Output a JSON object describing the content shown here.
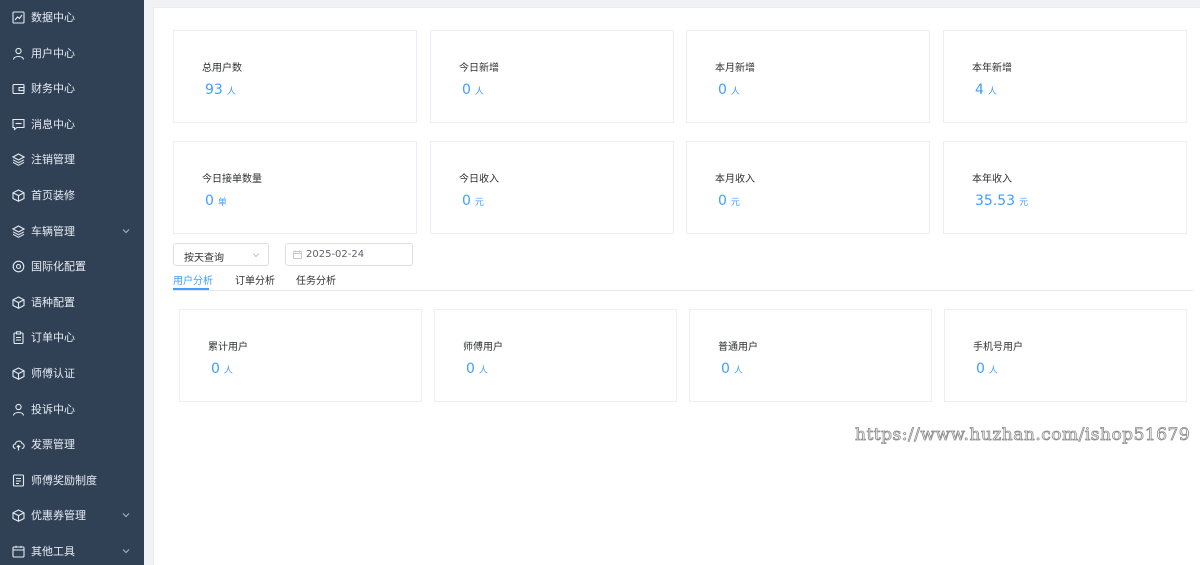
{
  "sidebar": {
    "items": [
      {
        "label": "数据中心",
        "icon": "chart-icon",
        "has_arrow": false
      },
      {
        "label": "用户中心",
        "icon": "user-icon",
        "has_arrow": false
      },
      {
        "label": "财务中心",
        "icon": "wallet-icon",
        "has_arrow": false
      },
      {
        "label": "消息中心",
        "icon": "message-icon",
        "has_arrow": false
      },
      {
        "label": "注销管理",
        "icon": "layers-icon",
        "has_arrow": false
      },
      {
        "label": "首页装修",
        "icon": "box-icon",
        "has_arrow": false
      },
      {
        "label": "车辆管理",
        "icon": "layers-icon",
        "has_arrow": true
      },
      {
        "label": "国际化配置",
        "icon": "settings-icon",
        "has_arrow": false
      },
      {
        "label": "语种配置",
        "icon": "box-icon",
        "has_arrow": false
      },
      {
        "label": "订单中心",
        "icon": "clipboard-icon",
        "has_arrow": false
      },
      {
        "label": "师傅认证",
        "icon": "box-icon",
        "has_arrow": false
      },
      {
        "label": "投诉中心",
        "icon": "user-icon",
        "has_arrow": false
      },
      {
        "label": "发票管理",
        "icon": "cloud-upload-icon",
        "has_arrow": false
      },
      {
        "label": "师傅奖励制度",
        "icon": "document-icon",
        "has_arrow": false
      },
      {
        "label": "优惠券管理",
        "icon": "box-icon",
        "has_arrow": true
      },
      {
        "label": "其他工具",
        "icon": "calendar-icon",
        "has_arrow": true
      }
    ]
  },
  "stats_row1": [
    {
      "title": "总用户数",
      "value": "93",
      "unit": "人"
    },
    {
      "title": "今日新增",
      "value": "0",
      "unit": "人"
    },
    {
      "title": "本月新增",
      "value": "0",
      "unit": "人"
    },
    {
      "title": "本年新增",
      "value": "4",
      "unit": "人"
    }
  ],
  "stats_row2": [
    {
      "title": "今日接单数量",
      "value": "0",
      "unit": "单"
    },
    {
      "title": "今日收入",
      "value": "0",
      "unit": "元"
    },
    {
      "title": "本月收入",
      "value": "0",
      "unit": "元"
    },
    {
      "title": "本年收入",
      "value": "35.53",
      "unit": "元"
    }
  ],
  "filter": {
    "query_mode": "按天查询",
    "date": "2025-02-24"
  },
  "tabs": [
    {
      "label": "用户分析",
      "active": true
    },
    {
      "label": "订单分析",
      "active": false
    },
    {
      "label": "任务分析",
      "active": false
    }
  ],
  "analysis_cards": [
    {
      "title": "累计用户",
      "value": "0",
      "unit": "人"
    },
    {
      "title": "师傅用户",
      "value": "0",
      "unit": "人"
    },
    {
      "title": "普通用户",
      "value": "0",
      "unit": "人"
    },
    {
      "title": "手机号用户",
      "value": "0",
      "unit": "人"
    }
  ],
  "watermark": "https://www.huzhan.com/ishop51679",
  "colors": {
    "sidebar_bg": "#304156",
    "accent": "#409eff"
  }
}
